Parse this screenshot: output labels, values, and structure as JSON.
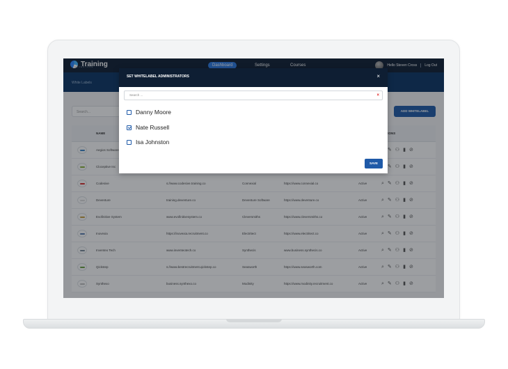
{
  "header": {
    "logo_text": "Training",
    "logo_subtext": "ADVENTURE",
    "nav": [
      "Dashboard",
      "Settings",
      "Courses"
    ],
    "active_nav": "Dashboard",
    "greeting": "Hello Steven Cross",
    "logout": "Log Out"
  },
  "subbar": {
    "title": "White Labels"
  },
  "toolbar": {
    "search_placeholder": "Search...",
    "add_button": "ADD WHITELABEL"
  },
  "table": {
    "columns": [
      "NAME",
      "ACTIONS"
    ],
    "rows": [
      {
        "name": "Aegios Software",
        "url": "",
        "company": "",
        "website": "",
        "status": "",
        "logo_color": "#3a86c8"
      },
      {
        "name": "Cloceptive Inc",
        "url": "",
        "company": "",
        "website": "",
        "status": "",
        "logo_color": "#8bb43c"
      },
      {
        "name": "Codesive",
        "url": "s://www.codesive.training.co",
        "company": "Connexial",
        "website": "https://www.connexial.co",
        "status": "Active",
        "logo_color": "#d93030"
      },
      {
        "name": "Deventure",
        "url": "training.deventure.co",
        "company": "Deventure Software",
        "website": "https://www.deventure.co",
        "status": "Active",
        "logo_color": "#dddddd"
      },
      {
        "name": "Evofinitive System",
        "url": "www.evofinitivesystem.co",
        "company": "Cleversmiths",
        "website": "https://www.cleversmiths.co",
        "status": "Active",
        "logo_color": "#c9a040"
      },
      {
        "name": "Inovexia",
        "url": "https://inovexia.recruitment.co",
        "company": "Electritect",
        "website": "https://www.electritect.co",
        "status": "Active",
        "logo_color": "#5a7fb0"
      },
      {
        "name": "Inventeo Tech",
        "url": "www.inventeotech.co",
        "company": "Synthecis",
        "website": "www.business.synthecis.co",
        "status": "Active",
        "logo_color": "#7a8a9a"
      },
      {
        "name": "Qickstep",
        "url": "s://www.bestrecruitment.qickstep.co",
        "company": "Seasworth",
        "website": "https://www.seasworth.com",
        "status": "Active",
        "logo_color": "#6aa040"
      },
      {
        "name": "Synthexo",
        "url": "business.synthexo.co",
        "company": "Modinity",
        "website": "https://www.modinity.recruitment.co",
        "status": "Active",
        "logo_color": "#c0c0c0"
      }
    ]
  },
  "modal": {
    "title": "SET WHITELABEL ADMINISTRATORS",
    "close_icon": "close-icon",
    "search_placeholder": "Search ...",
    "clear_glyph": "×",
    "close_glyph": "×",
    "options": [
      {
        "label": "Danny Moore",
        "checked": false
      },
      {
        "label": "Nate Russell",
        "checked": true
      },
      {
        "label": "Isa Johnston",
        "checked": false
      }
    ],
    "save_label": "SAVE"
  },
  "icons": {
    "action_icons": [
      "view-icon",
      "edit-icon",
      "users-icon",
      "stats-icon",
      "block-icon"
    ]
  }
}
